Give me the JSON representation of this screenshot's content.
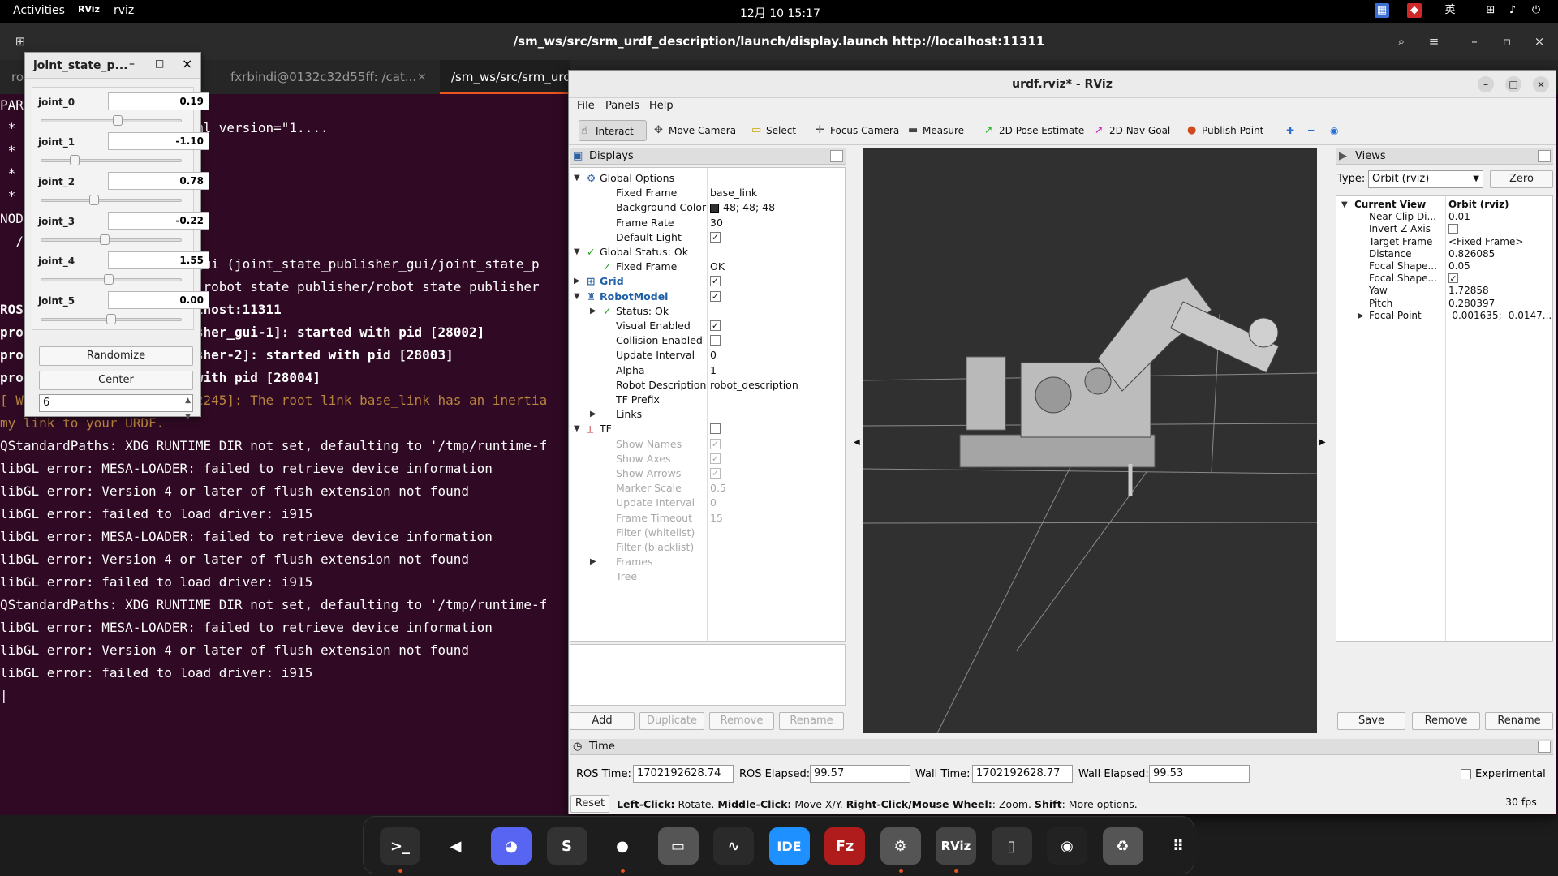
{
  "topbar": {
    "activities": "Activities",
    "app": "rviz",
    "clock": "12月 10  15:17",
    "ime": "英"
  },
  "terminal": {
    "title": "/sm_ws/src/srm_urdf_description/launch/display.launch http://localhost:11311",
    "tabs": [
      "ro",
      "fxrbindi@0132c32d55ff: /cat...",
      "/sm_ws/src/srm_urdf"
    ],
    "lines": [
      {
        "t": "PARA",
        "c": "d"
      },
      {
        "t": " * /                    xml version=\"1....",
        "c": "d"
      },
      {
        "t": " * /",
        "c": "d"
      },
      {
        "t": " * /",
        "c": "d"
      },
      {
        "t": " * /",
        "c": "d"
      },
      {
        "t": "",
        "c": "d"
      },
      {
        "t": "NODE",
        "c": "d"
      },
      {
        "t": "  /",
        "c": "d"
      },
      {
        "t": "                        _gui (joint_state_publisher_gui/joint_state_p",
        "c": "d"
      },
      {
        "t": "                         (robot_state_publisher/robot_state_publisher",
        "c": "d"
      },
      {
        "t": "",
        "c": "d"
      },
      {
        "t": "ROS_                    alhost:11311",
        "c": "b"
      },
      {
        "t": "",
        "c": "d"
      },
      {
        "t": "process[joint_state_publisher_gui-1]: started with pid [28002]",
        "c": "b"
      },
      {
        "t": "process[robot_state_publisher-2]: started with pid [28003]",
        "c": "b"
      },
      {
        "t": "process[rviz-3]: started with pid [28004]",
        "c": "b"
      },
      {
        "t": "[ WARN] [1702192528.678942245]: The root link base_link has an inertia",
        "c": "w"
      },
      {
        "t": "my link to your URDF.",
        "c": "w"
      },
      {
        "t": "QStandardPaths: XDG_RUNTIME_DIR not set, defaulting to '/tmp/runtime-f",
        "c": "d"
      },
      {
        "t": "libGL error: MESA-LOADER: failed to retrieve device information",
        "c": "d"
      },
      {
        "t": "libGL error: Version 4 or later of flush extension not found",
        "c": "d"
      },
      {
        "t": "libGL error: failed to load driver: i915",
        "c": "d"
      },
      {
        "t": "libGL error: MESA-LOADER: failed to retrieve device information",
        "c": "d"
      },
      {
        "t": "libGL error: Version 4 or later of flush extension not found",
        "c": "d"
      },
      {
        "t": "libGL error: failed to load driver: i915",
        "c": "d"
      },
      {
        "t": "QStandardPaths: XDG_RUNTIME_DIR not set, defaulting to '/tmp/runtime-f",
        "c": "d"
      },
      {
        "t": "libGL error: MESA-LOADER: failed to retrieve device information",
        "c": "d"
      },
      {
        "t": "libGL error: Version 4 or later of flush extension not found",
        "c": "d"
      },
      {
        "t": "libGL error: failed to load driver: i915",
        "c": "d"
      },
      {
        "t": "|",
        "c": "d"
      }
    ]
  },
  "jsp": {
    "title": "joint_state_p...",
    "joints": [
      {
        "name": "joint_0",
        "value": "0.19",
        "frac": 0.55
      },
      {
        "name": "joint_1",
        "value": "-1.10",
        "frac": 0.22
      },
      {
        "name": "joint_2",
        "value": "0.78",
        "frac": 0.37
      },
      {
        "name": "joint_3",
        "value": "-0.22",
        "frac": 0.45
      },
      {
        "name": "joint_4",
        "value": "1.55",
        "frac": 0.48
      },
      {
        "name": "joint_5",
        "value": "0.00",
        "frac": 0.5
      }
    ],
    "randomize": "Randomize",
    "center": "Center",
    "spin": "6"
  },
  "rviz": {
    "title": "urdf.rviz* - RViz",
    "menu": [
      "File",
      "Panels",
      "Help"
    ],
    "tools": [
      {
        "label": "Interact",
        "icon": "cursor-icon"
      },
      {
        "label": "Move Camera",
        "icon": "move-icon"
      },
      {
        "label": "Select",
        "icon": "select-icon"
      },
      {
        "label": "Focus Camera",
        "icon": "focus-icon"
      },
      {
        "label": "Measure",
        "icon": "ruler-icon"
      },
      {
        "label": "2D Pose Estimate",
        "icon": "pose-icon"
      },
      {
        "label": "2D Nav Goal",
        "icon": "nav-icon"
      },
      {
        "label": "Publish Point",
        "icon": "pin-icon"
      }
    ],
    "displays": {
      "header": "Displays",
      "rows": [
        {
          "label": "Global Options",
          "value": "",
          "indent": 0,
          "arrow": "open",
          "style": "n",
          "check": ""
        },
        {
          "label": "Fixed Frame",
          "value": "base_link",
          "indent": 1,
          "arrow": "",
          "style": "n",
          "check": ""
        },
        {
          "label": "Background Color",
          "value": "48; 48; 48",
          "indent": 1,
          "arrow": "",
          "style": "n",
          "check": "swatch"
        },
        {
          "label": "Frame Rate",
          "value": "30",
          "indent": 1,
          "arrow": "",
          "style": "n",
          "check": ""
        },
        {
          "label": "Default Light",
          "value": "",
          "indent": 1,
          "arrow": "",
          "style": "n",
          "check": "on"
        },
        {
          "label": "Global Status: Ok",
          "value": "",
          "indent": 0,
          "arrow": "open",
          "style": "n",
          "check": ""
        },
        {
          "label": "Fixed Frame",
          "value": "OK",
          "indent": 1,
          "arrow": "",
          "style": "n",
          "check": ""
        },
        {
          "label": "Grid",
          "value": "",
          "indent": 0,
          "arrow": "closed",
          "style": "blue",
          "check": "on"
        },
        {
          "label": "RobotModel",
          "value": "",
          "indent": 0,
          "arrow": "open",
          "style": "blue",
          "check": "on"
        },
        {
          "label": "Status: Ok",
          "value": "",
          "indent": 1,
          "arrow": "closed",
          "style": "n",
          "check": ""
        },
        {
          "label": "Visual Enabled",
          "value": "",
          "indent": 1,
          "arrow": "",
          "style": "n",
          "check": "on"
        },
        {
          "label": "Collision Enabled",
          "value": "",
          "indent": 1,
          "arrow": "",
          "style": "n",
          "check": "off"
        },
        {
          "label": "Update Interval",
          "value": "0",
          "indent": 1,
          "arrow": "",
          "style": "n",
          "check": ""
        },
        {
          "label": "Alpha",
          "value": "1",
          "indent": 1,
          "arrow": "",
          "style": "n",
          "check": ""
        },
        {
          "label": "Robot Description",
          "value": "robot_description",
          "indent": 1,
          "arrow": "",
          "style": "n",
          "check": ""
        },
        {
          "label": "TF Prefix",
          "value": "",
          "indent": 1,
          "arrow": "",
          "style": "n",
          "check": ""
        },
        {
          "label": "Links",
          "value": "",
          "indent": 1,
          "arrow": "closed",
          "style": "n",
          "check": ""
        },
        {
          "label": "TF",
          "value": "",
          "indent": 0,
          "arrow": "open",
          "style": "n",
          "check": "off"
        },
        {
          "label": "Show Names",
          "value": "",
          "indent": 1,
          "arrow": "",
          "style": "g",
          "check": "gon"
        },
        {
          "label": "Show Axes",
          "value": "",
          "indent": 1,
          "arrow": "",
          "style": "g",
          "check": "gon"
        },
        {
          "label": "Show Arrows",
          "value": "",
          "indent": 1,
          "arrow": "",
          "style": "g",
          "check": "gon"
        },
        {
          "label": "Marker Scale",
          "value": "0.5",
          "indent": 1,
          "arrow": "",
          "style": "g",
          "check": ""
        },
        {
          "label": "Update Interval",
          "value": "0",
          "indent": 1,
          "arrow": "",
          "style": "g",
          "check": ""
        },
        {
          "label": "Frame Timeout",
          "value": "15",
          "indent": 1,
          "arrow": "",
          "style": "g",
          "check": ""
        },
        {
          "label": "Filter (whitelist)",
          "value": "",
          "indent": 1,
          "arrow": "",
          "style": "g",
          "check": ""
        },
        {
          "label": "Filter (blacklist)",
          "value": "",
          "indent": 1,
          "arrow": "",
          "style": "g",
          "check": ""
        },
        {
          "label": "Frames",
          "value": "",
          "indent": 1,
          "arrow": "closed",
          "style": "g",
          "check": ""
        },
        {
          "label": "Tree",
          "value": "",
          "indent": 1,
          "arrow": "",
          "style": "g",
          "check": ""
        }
      ],
      "buttons": [
        "Add",
        "Duplicate",
        "Remove",
        "Rename"
      ]
    },
    "views": {
      "header": "Views",
      "type_label": "Type:",
      "type_value": "Orbit (rviz)",
      "zero": "Zero",
      "rows": [
        {
          "label": "Current View",
          "value": "Orbit (rviz)",
          "bold": true,
          "arrow": "open",
          "check": false
        },
        {
          "label": "Near Clip Di...",
          "value": "0.01",
          "bold": false,
          "arrow": "",
          "check": false
        },
        {
          "label": "Invert Z Axis",
          "value": "",
          "bold": false,
          "arrow": "",
          "check": "off"
        },
        {
          "label": "Target Frame",
          "value": "<Fixed Frame>",
          "bold": false,
          "arrow": "",
          "check": false
        },
        {
          "label": "Distance",
          "value": "0.826085",
          "bold": false,
          "arrow": "",
          "check": false
        },
        {
          "label": "Focal Shape...",
          "value": "0.05",
          "bold": false,
          "arrow": "",
          "check": false
        },
        {
          "label": "Focal Shape...",
          "value": "",
          "bold": false,
          "arrow": "",
          "check": "on"
        },
        {
          "label": "Yaw",
          "value": "1.72858",
          "bold": false,
          "arrow": "",
          "check": false
        },
        {
          "label": "Pitch",
          "value": "0.280397",
          "bold": false,
          "arrow": "",
          "check": false
        },
        {
          "label": "Focal Point",
          "value": "-0.001635; -0.0147...",
          "bold": false,
          "arrow": "closed",
          "check": false
        }
      ],
      "buttons": [
        "Save",
        "Remove",
        "Rename"
      ]
    },
    "time": {
      "header": "Time",
      "ros_time_label": "ROS Time:",
      "ros_time": "1702192628.74",
      "ros_elapsed_label": "ROS Elapsed:",
      "ros_elapsed": "99.57",
      "wall_time_label": "Wall Time:",
      "wall_time": "1702192628.77",
      "wall_elapsed_label": "Wall Elapsed:",
      "wall_elapsed": "99.53",
      "experimental": "Experimental"
    },
    "status": {
      "reset": "Reset",
      "hint_parts": [
        "Left-Click:",
        " Rotate. ",
        "Middle-Click:",
        " Move X/Y. ",
        "Right-Click/Mouse Wheel:",
        ": Zoom. ",
        "Shift",
        ": More options."
      ],
      "fps": "30 fps"
    }
  },
  "dock": [
    {
      "name": "terminal",
      "glyph": ">_",
      "bg": "#2e2e2e",
      "running": true
    },
    {
      "name": "vscode",
      "glyph": "◀",
      "bg": "#1d1d1d",
      "running": false
    },
    {
      "name": "discord",
      "glyph": "◕",
      "bg": "#5865f2",
      "running": false
    },
    {
      "name": "sublime",
      "glyph": "S",
      "bg": "#333",
      "running": false
    },
    {
      "name": "chrome",
      "glyph": "●",
      "bg": "#1d1d1d",
      "running": true
    },
    {
      "name": "files",
      "glyph": "▭",
      "bg": "#555",
      "running": false
    },
    {
      "name": "monitor",
      "glyph": "∿",
      "bg": "#2a2a2a",
      "running": false
    },
    {
      "name": "ide",
      "glyph": "IDE",
      "bg": "#1e90ff",
      "running": false
    },
    {
      "name": "filezilla",
      "glyph": "Fz",
      "bg": "#b01c1c",
      "running": false
    },
    {
      "name": "settings",
      "glyph": "⚙",
      "bg": "#555",
      "running": true
    },
    {
      "name": "rviz",
      "glyph": "RViz",
      "bg": "#444",
      "running": true
    },
    {
      "name": "app",
      "glyph": "▯",
      "bg": "#333",
      "running": false
    },
    {
      "name": "camera",
      "glyph": "◉",
      "bg": "#222",
      "running": false
    },
    {
      "name": "trash",
      "glyph": "♻",
      "bg": "#555",
      "running": false
    },
    {
      "name": "apps",
      "glyph": "⠿",
      "bg": "#1d1d1d",
      "running": false
    }
  ]
}
